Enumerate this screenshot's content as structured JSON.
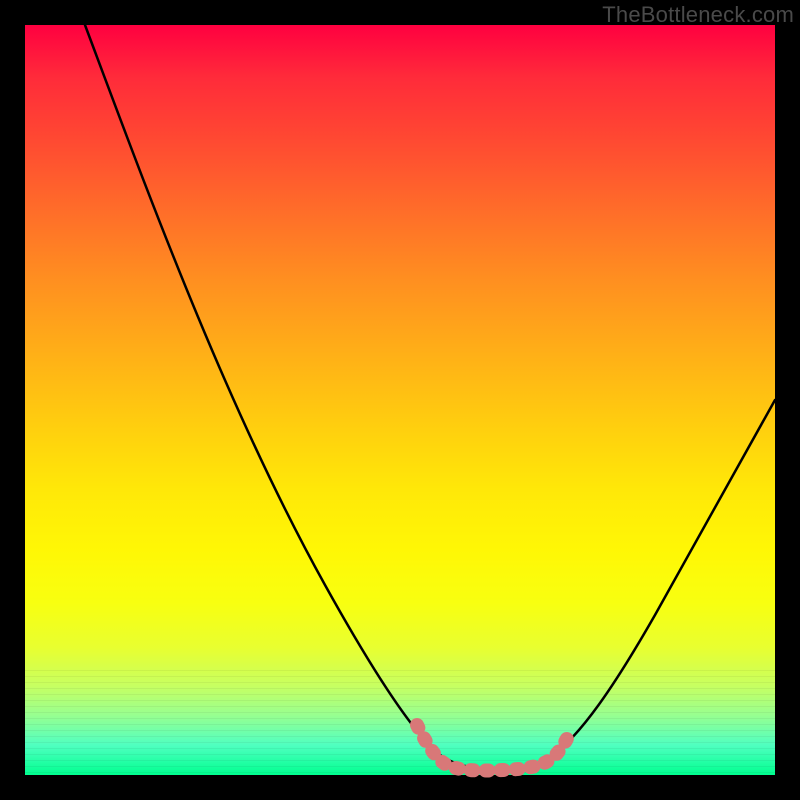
{
  "attribution": "TheBottleneck.com",
  "colors": {
    "frame": "#000000",
    "gradient_top": "#ff0040",
    "gradient_bottom": "#00ff90",
    "curve_stroke": "#000000",
    "highlight_stroke": "#d87878"
  },
  "chart_data": {
    "type": "line",
    "title": "",
    "xlabel": "",
    "ylabel": "",
    "xlim": [
      0,
      100
    ],
    "ylim": [
      0,
      100
    ],
    "series": [
      {
        "name": "bottleneck-curve",
        "x": [
          0,
          5,
          10,
          15,
          20,
          25,
          30,
          35,
          40,
          45,
          50,
          53,
          55,
          58,
          60,
          63,
          65,
          68,
          70,
          75,
          80,
          85,
          90,
          95,
          100
        ],
        "y": [
          100,
          92,
          84,
          76,
          68,
          59,
          50,
          41,
          32,
          22,
          12,
          7,
          4,
          2,
          1,
          1,
          1,
          2,
          4,
          10,
          18,
          27,
          36,
          45,
          54
        ]
      }
    ],
    "highlights": [
      {
        "name": "flat-minimum",
        "x_range": [
          53,
          70
        ],
        "y": 2
      }
    ],
    "annotations": []
  }
}
